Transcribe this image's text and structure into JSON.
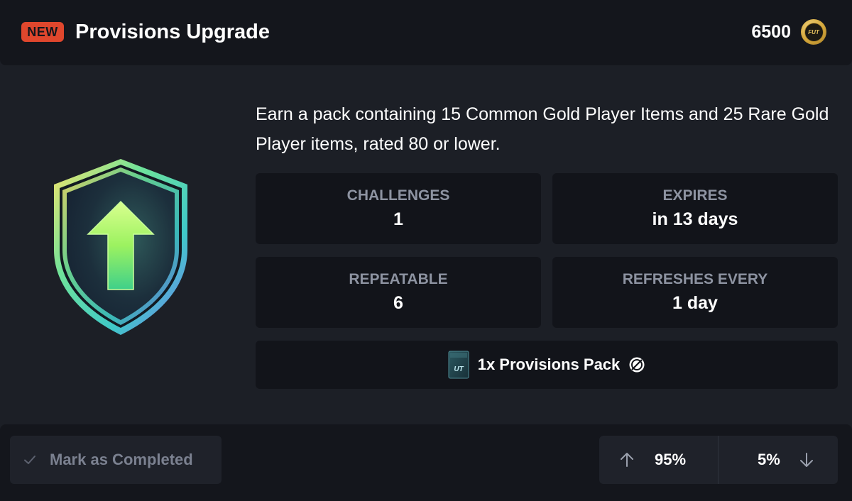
{
  "header": {
    "badge": "NEW",
    "title": "Provisions Upgrade",
    "price": "6500",
    "coin_label": "FUT"
  },
  "objective": {
    "icon": "upgrade-shield-icon",
    "description": "Earn a pack containing 15 Common Gold Player Items and 25 Rare Gold Player items, rated 80 or lower."
  },
  "stats": {
    "challenges": {
      "label": "CHALLENGES",
      "value": "1"
    },
    "expires": {
      "label": "EXPIRES",
      "value": "in 13 days"
    },
    "repeatable": {
      "label": "REPEATABLE",
      "value": "6"
    },
    "refreshes": {
      "label": "REFRESHES EVERY",
      "value": "1 day"
    }
  },
  "reward": {
    "label": "1x Provisions Pack",
    "pack_icon_text": "UT",
    "untradeable_icon": "untradeable-icon"
  },
  "footer": {
    "complete_label": "Mark as Completed",
    "upvote": "95%",
    "downvote": "5%"
  },
  "colors": {
    "background": "#1c1f26",
    "panel": "#14161c",
    "tile": "#12141a",
    "badge": "#e0472d",
    "muted_text": "#8d93a1",
    "arrow_green": "#8ff05a"
  }
}
